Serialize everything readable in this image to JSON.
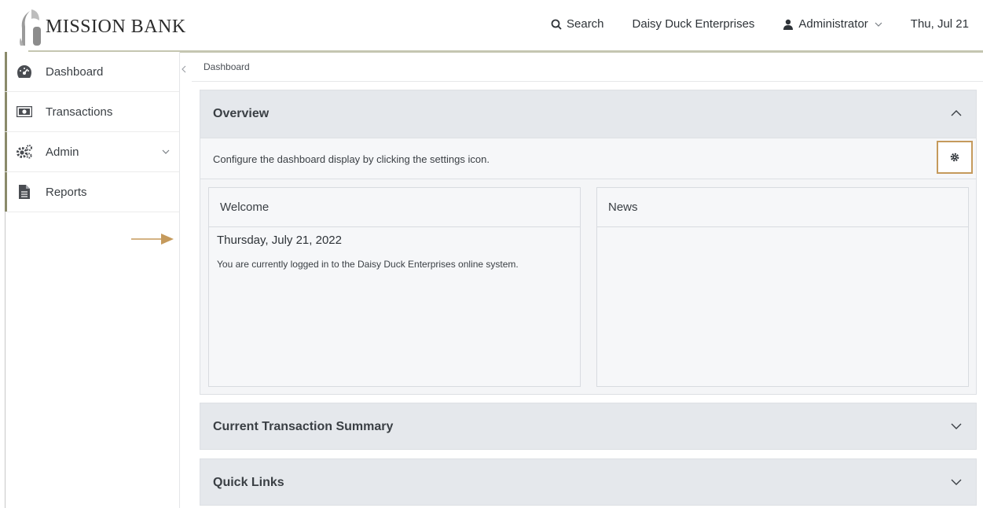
{
  "header": {
    "logo_text": "MISSION BANK",
    "search_label": "Search",
    "company": "Daisy Duck Enterprises",
    "user": "Administrator",
    "date": "Thu, Jul 21"
  },
  "sidebar": {
    "items": [
      {
        "label": "Dashboard",
        "icon": "dashboard-gauge-icon"
      },
      {
        "label": "Transactions",
        "icon": "money-bill-icon"
      },
      {
        "label": "Admin",
        "icon": "gears-icon"
      },
      {
        "label": "Reports",
        "icon": "document-icon"
      }
    ]
  },
  "breadcrumb": "Dashboard",
  "overview": {
    "title": "Overview",
    "config_text": "Configure the dashboard display by clicking the settings icon.",
    "welcome": {
      "title": "Welcome",
      "date": "Thursday, July 21, 2022",
      "message": "You are currently logged in to the Daisy Duck Enterprises online system."
    },
    "news": {
      "title": "News"
    }
  },
  "panels": {
    "summary_title": "Current Transaction Summary",
    "quick_links_title": "Quick Links"
  },
  "colors": {
    "accent": "#c59a5c",
    "rule": "#c5c6b1",
    "sidebar_bar": "#8a8a6a",
    "panel_bg": "#e5e8ec"
  }
}
